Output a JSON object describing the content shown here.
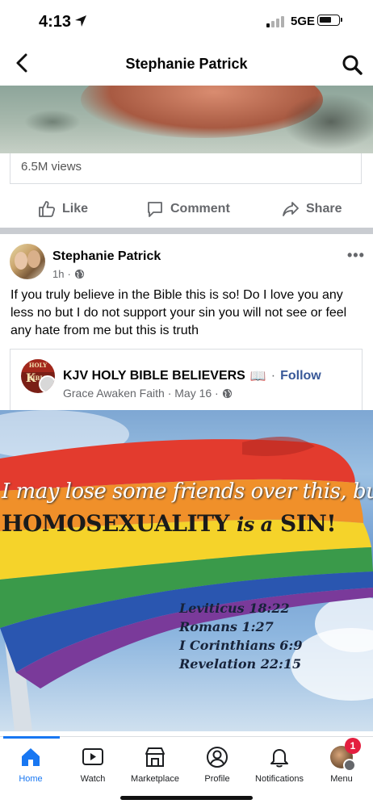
{
  "status_bar": {
    "time": "4:13",
    "network": "5GE"
  },
  "nav": {
    "title": "Stephanie Patrick",
    "back_icon": "chevron-left-icon",
    "search_icon": "search-icon"
  },
  "video_post": {
    "views": "6.5M views",
    "actions": {
      "like": "Like",
      "comment": "Comment",
      "share": "Share"
    }
  },
  "post": {
    "author": "Stephanie Patrick",
    "time": "1h",
    "meta_sep": "·",
    "privacy_icon": "globe-icon",
    "more": "•••",
    "text": "If you truly believe in the Bible this is so! Do I love you any less no but I do not support your sin you will not see or feel any hate from me but this is truth",
    "shared": {
      "page_name": "KJV  HOLY BIBLE BELIEVERS",
      "page_emoji": "📖",
      "sep": "·",
      "follow": "Follow",
      "avatar_top": "HOLY BIBLE",
      "avatar_letter": "K",
      "page_meta": "Grace Awaken Faith · May 16 ·",
      "image": {
        "line1": "I may lose some friends over this, but",
        "line2_a": "HOMOSEXUALITY",
        "line2_b": "is a",
        "line2_c": "SIN!",
        "verses": [
          "Leviticus 18:22",
          "Romans 1:27",
          "I Corinthians 6:9",
          "Revelation 22:15"
        ],
        "flag_colors": [
          "#e33b2e",
          "#f0902a",
          "#f5d32a",
          "#3a9a4a",
          "#2a56b0",
          "#7a3a9a"
        ]
      }
    }
  },
  "tabs": [
    {
      "label": "Home",
      "icon": "home-icon",
      "active": true
    },
    {
      "label": "Watch",
      "icon": "watch-icon",
      "active": false
    },
    {
      "label": "Marketplace",
      "icon": "marketplace-icon",
      "active": false
    },
    {
      "label": "Profile",
      "icon": "profile-icon",
      "active": false
    },
    {
      "label": "Notifications",
      "icon": "bell-icon",
      "active": false
    },
    {
      "label": "Menu",
      "icon": "menu-avatar-icon",
      "active": false,
      "badge": "1"
    }
  ],
  "colors": {
    "accent": "#1877f2",
    "follow": "#385898",
    "badge": "#e41e3f",
    "secondary_text": "#65676b"
  }
}
